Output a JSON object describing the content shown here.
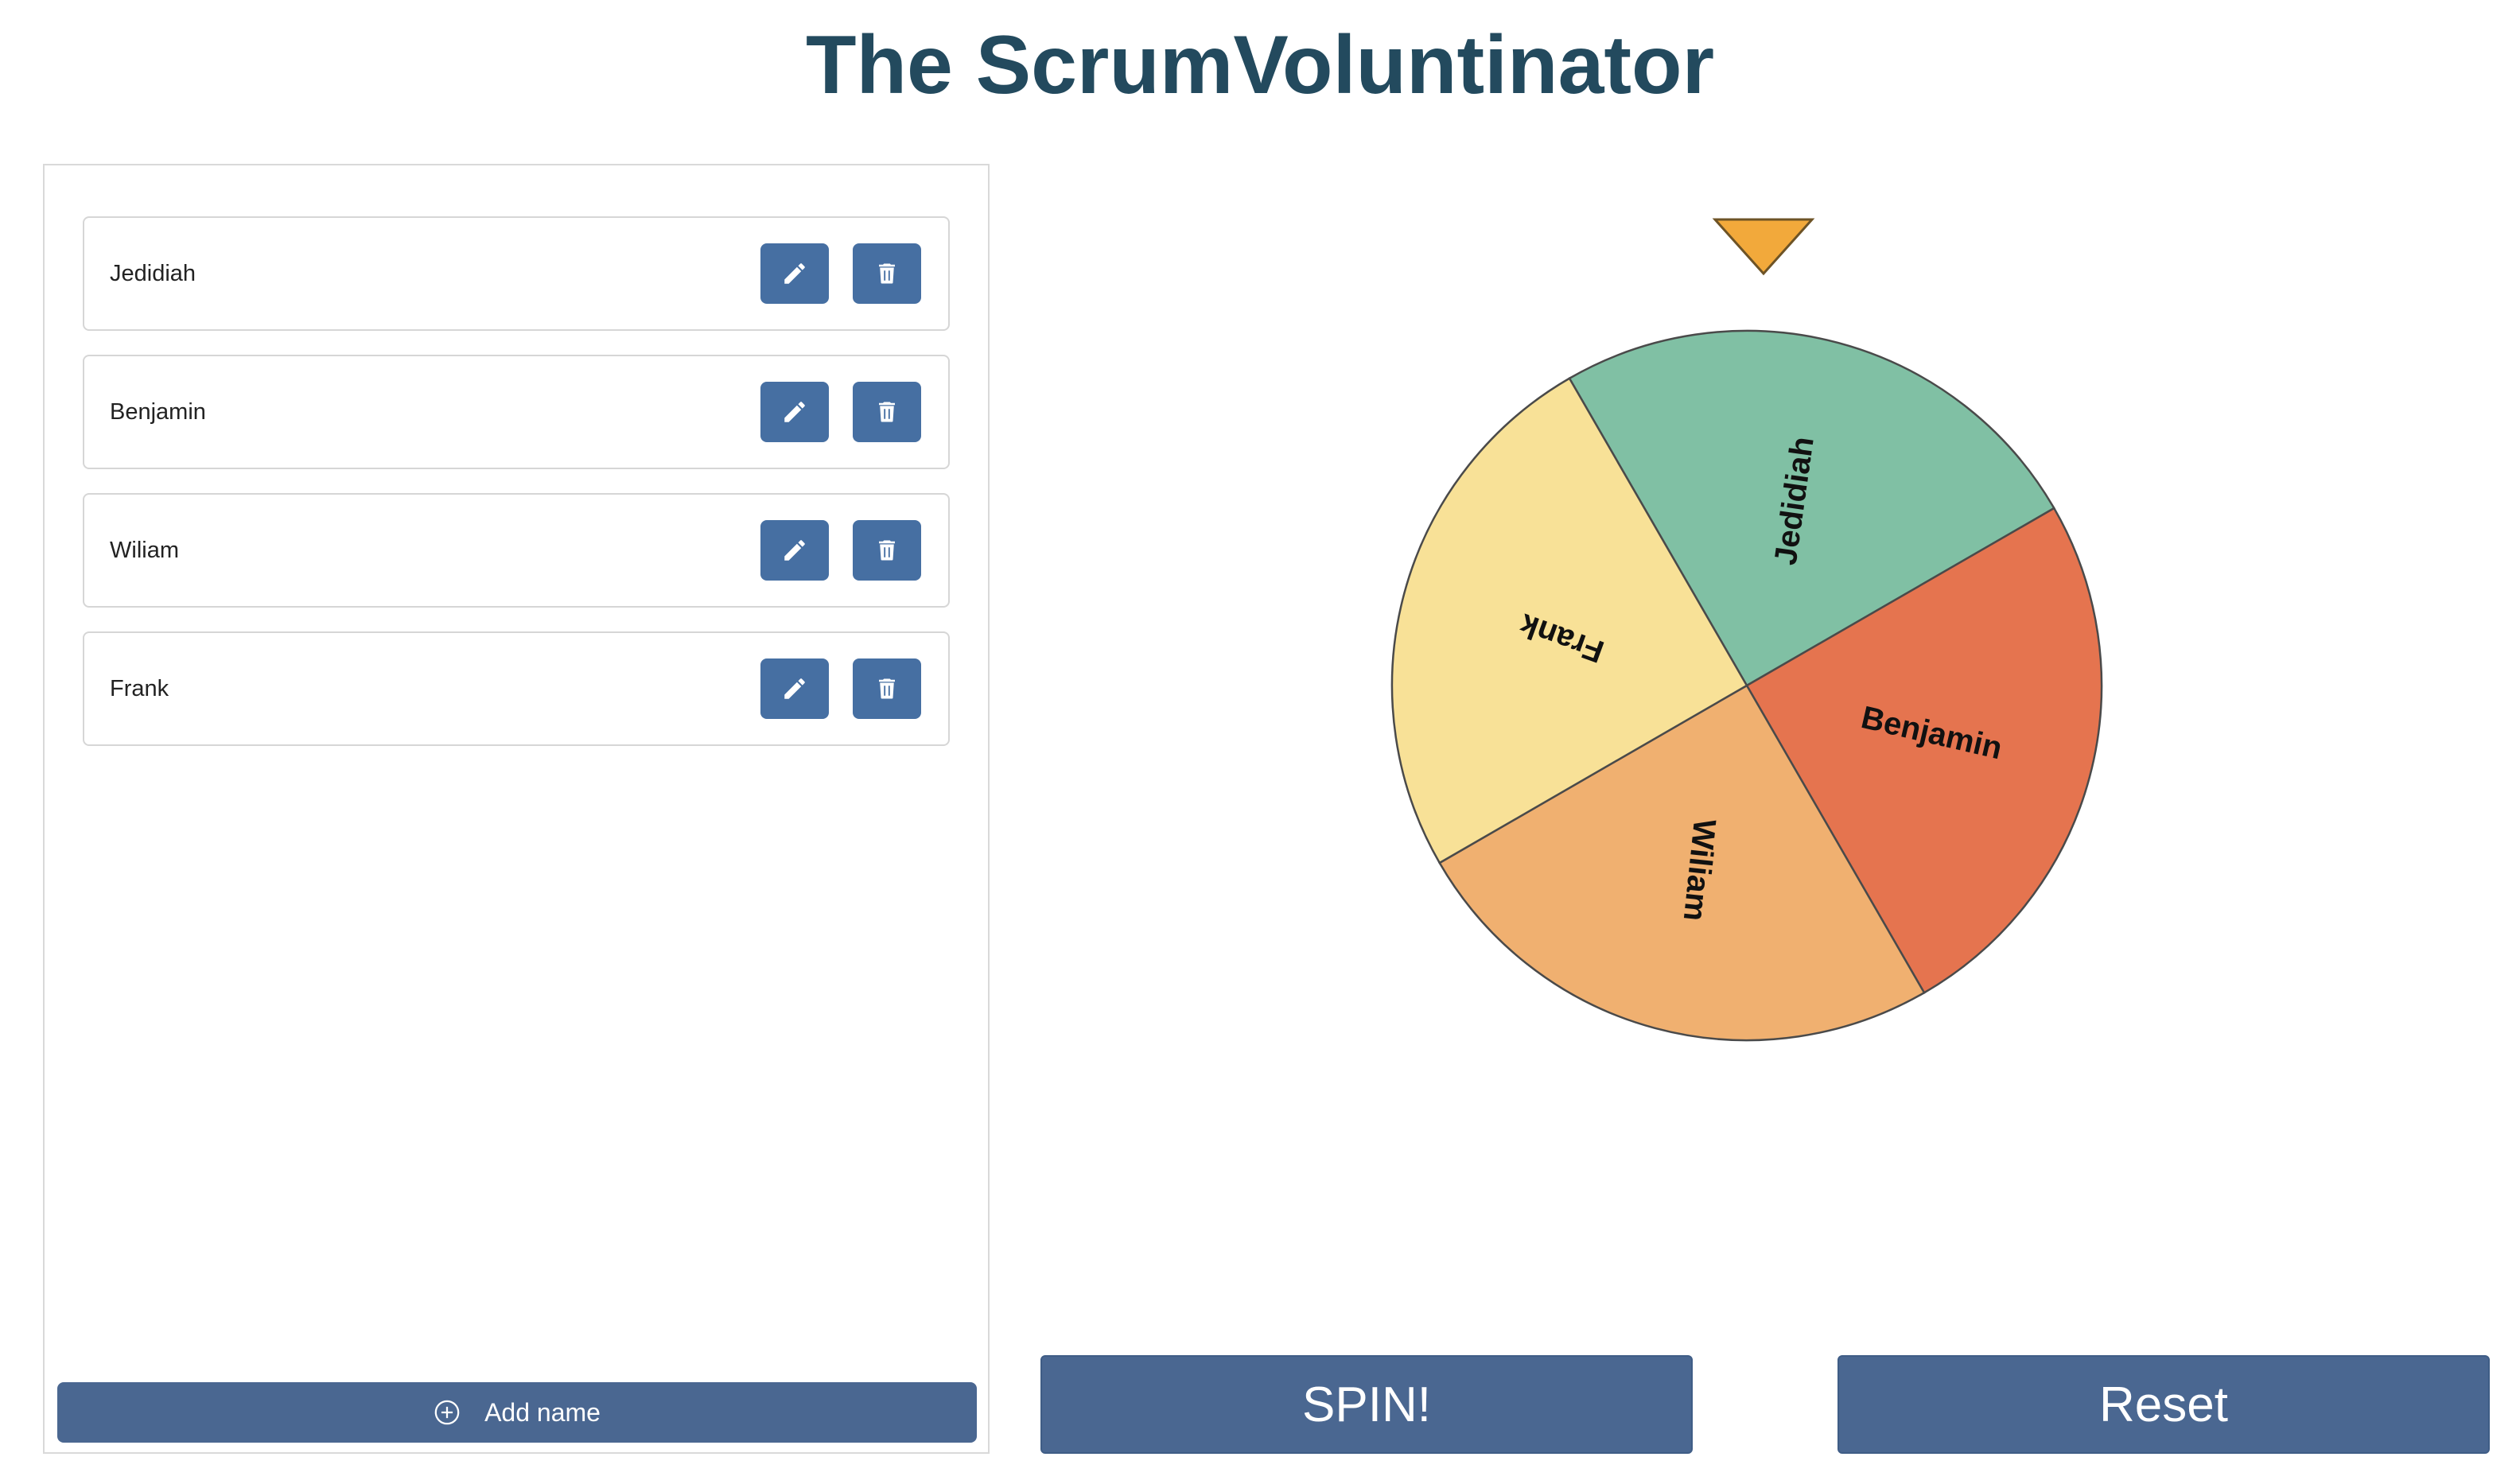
{
  "title": "The ScrumVoluntinator",
  "names": [
    {
      "label": "Jedidiah"
    },
    {
      "label": "Benjamin"
    },
    {
      "label": "Wiliam"
    },
    {
      "label": "Frank"
    }
  ],
  "icons": {
    "edit": "pencil-icon",
    "delete": "trash-icon",
    "add": "plus-circle-icon"
  },
  "add_button": {
    "label": "Add name"
  },
  "wheel": {
    "segments": [
      {
        "label": "Jedidiah",
        "color": "#80c0a4"
      },
      {
        "label": "Benjamin",
        "color": "#e5744f"
      },
      {
        "label": "Wiliam",
        "color": "#f0b070"
      },
      {
        "label": "Frank",
        "color": "#f8e197"
      }
    ],
    "pointer_color": "#f2a93b"
  },
  "buttons": {
    "spin": "SPIN!",
    "reset": "Reset"
  },
  "colors": {
    "title": "#234a5e",
    "button": "#4a6791",
    "icon_button": "#466fa2"
  }
}
